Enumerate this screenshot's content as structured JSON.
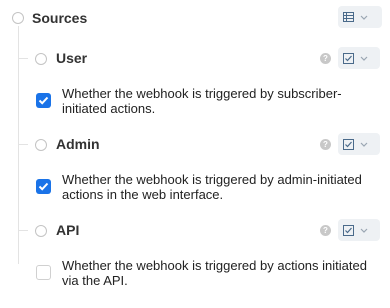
{
  "root": {
    "title": "Sources",
    "type_icon": "table-icon"
  },
  "items": [
    {
      "title": "User",
      "help_icon": "?",
      "type_icon": "checkbox-icon",
      "checked": true,
      "description": "Whether the webhook is triggered by subscriber-initiated actions."
    },
    {
      "title": "Admin",
      "help_icon": "?",
      "type_icon": "checkbox-icon",
      "checked": true,
      "description": "Whether the webhook is triggered by admin-initiated actions in the web interface."
    },
    {
      "title": "API",
      "help_icon": "?",
      "type_icon": "checkbox-icon",
      "checked": false,
      "description": "Whether the webhook is triggered by actions initiated via the API."
    }
  ],
  "colors": {
    "accent": "#1a73e8",
    "tree_line": "#e3e3e3",
    "button_bg": "#eef1f4"
  }
}
